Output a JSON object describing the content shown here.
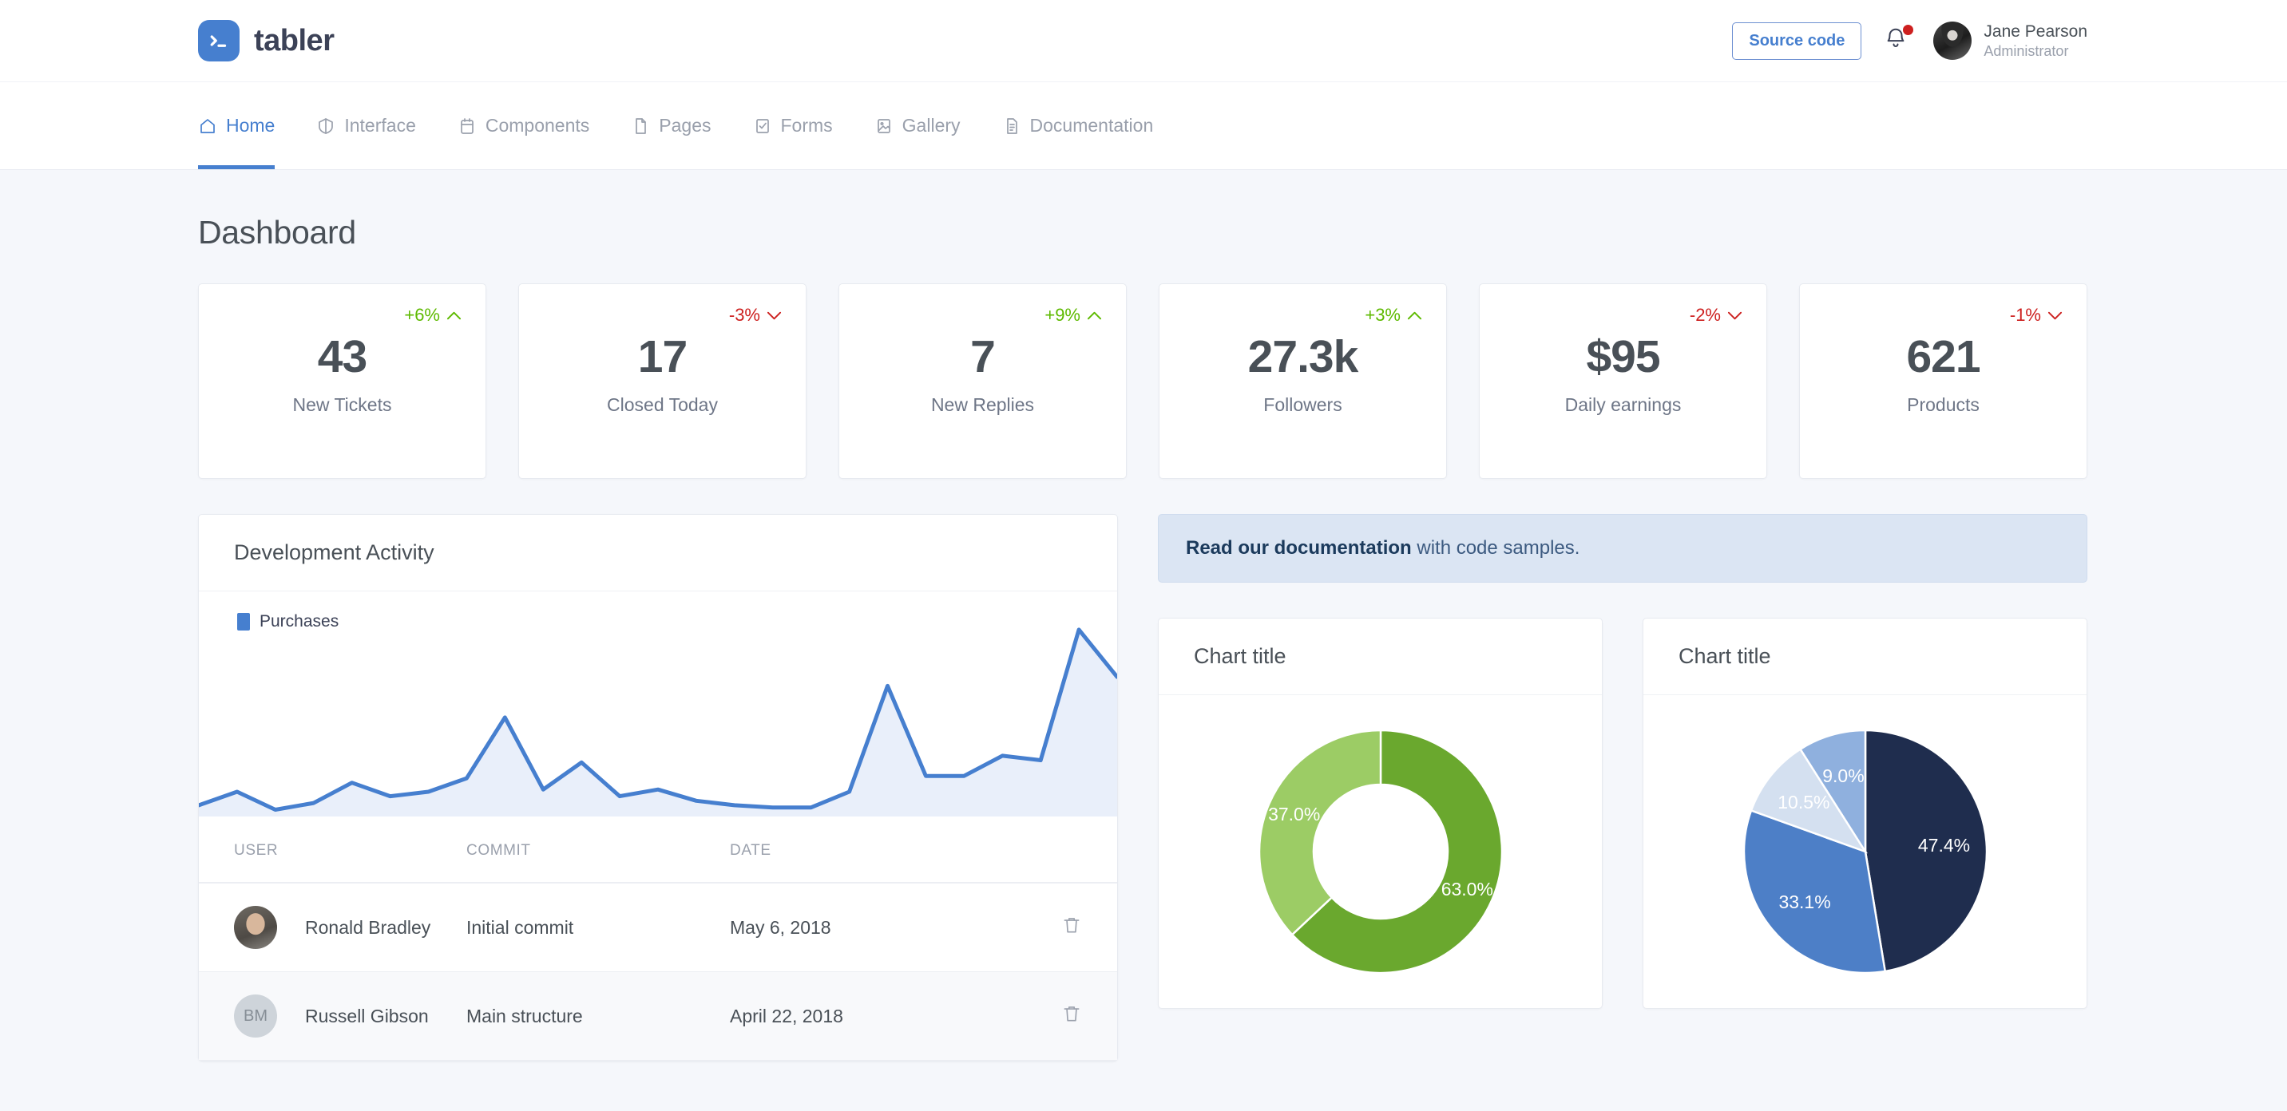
{
  "header": {
    "brand_name": "tabler",
    "logo_icon": "terminal-prompt-icon",
    "source_code_label": "Source code",
    "bell_icon": "notification-bell-icon",
    "user_name": "Jane Pearson",
    "user_role": "Administrator",
    "accent_color": "#467fcf"
  },
  "navbar": {
    "items": [
      {
        "label": "Home",
        "icon": "home-icon",
        "active": true
      },
      {
        "label": "Interface",
        "icon": "box-icon",
        "active": false
      },
      {
        "label": "Components",
        "icon": "calendar-icon",
        "active": false
      },
      {
        "label": "Pages",
        "icon": "file-icon",
        "active": false
      },
      {
        "label": "Forms",
        "icon": "check-square-icon",
        "active": false
      },
      {
        "label": "Gallery",
        "icon": "image-icon",
        "active": false
      },
      {
        "label": "Documentation",
        "icon": "document-icon",
        "active": false
      }
    ]
  },
  "page": {
    "title": "Dashboard"
  },
  "stats": [
    {
      "value": "43",
      "label": "New Tickets",
      "delta": "+6%",
      "direction": "up",
      "color": "#5eba00"
    },
    {
      "value": "17",
      "label": "Closed Today",
      "delta": "-3%",
      "direction": "down",
      "color": "#cd201f"
    },
    {
      "value": "7",
      "label": "New Replies",
      "delta": "+9%",
      "direction": "up",
      "color": "#5eba00"
    },
    {
      "value": "27.3k",
      "label": "Followers",
      "delta": "+3%",
      "direction": "up",
      "color": "#5eba00"
    },
    {
      "value": "$95",
      "label": "Daily earnings",
      "delta": "-2%",
      "direction": "down",
      "color": "#cd201f"
    },
    {
      "value": "621",
      "label": "Products",
      "delta": "-1%",
      "direction": "down",
      "color": "#cd201f"
    }
  ],
  "activity": {
    "title": "Development Activity",
    "table": {
      "columns": [
        "USER",
        "COMMIT",
        "DATE"
      ],
      "rows": [
        {
          "avatar_type": "photo",
          "avatar_text": "",
          "user": "Ronald Bradley",
          "commit": "Initial commit",
          "date": "May 6, 2018",
          "action_icon": "trash-icon"
        },
        {
          "avatar_type": "initials",
          "avatar_text": "BM",
          "user": "Russell Gibson",
          "commit": "Main structure",
          "date": "April 22, 2018",
          "action_icon": "trash-icon"
        }
      ]
    }
  },
  "alert": {
    "bold_text": "Read our documentation",
    "rest_text": " with code samples."
  },
  "donut_card": {
    "title": "Chart title"
  },
  "pie_card": {
    "title": "Chart title"
  },
  "chart_data": [
    {
      "type": "area",
      "title": "Development Activity",
      "legend": [
        "Purchases"
      ],
      "legend_position": "top-left",
      "series": [
        {
          "name": "Purchases",
          "color": "#467fcf",
          "fill": "#e9effa",
          "values": [
            5,
            11,
            3,
            6,
            15,
            9,
            11,
            17,
            44,
            12,
            24,
            9,
            12,
            7,
            5,
            4,
            4,
            11,
            58,
            18,
            18,
            27,
            25,
            83,
            62
          ]
        }
      ],
      "x": [
        1,
        2,
        3,
        4,
        5,
        6,
        7,
        8,
        9,
        10,
        11,
        12,
        13,
        14,
        15,
        16,
        17,
        18,
        19,
        20,
        21,
        22,
        23,
        24,
        25
      ],
      "xlabel": "",
      "ylabel": "",
      "ylim": [
        0,
        100
      ],
      "grid": false
    },
    {
      "type": "pie",
      "title": "Chart title",
      "variant": "donut",
      "labels": [
        "63.0%",
        "37.0%"
      ],
      "values": [
        63.0,
        37.0
      ],
      "colors": [
        "#6aa82e",
        "#9ccc65"
      ],
      "label_color": "#ffffff",
      "grid": false
    },
    {
      "type": "pie",
      "title": "Chart title",
      "variant": "pie",
      "labels": [
        "47.4%",
        "33.1%",
        "10.5%",
        "9.0%"
      ],
      "values": [
        47.4,
        33.1,
        10.5,
        9.0
      ],
      "colors": [
        "#1f2d4e",
        "#4d7fc7",
        "#d4e0f0",
        "#8fb0de"
      ],
      "label_color": "#ffffff",
      "grid": false
    }
  ]
}
